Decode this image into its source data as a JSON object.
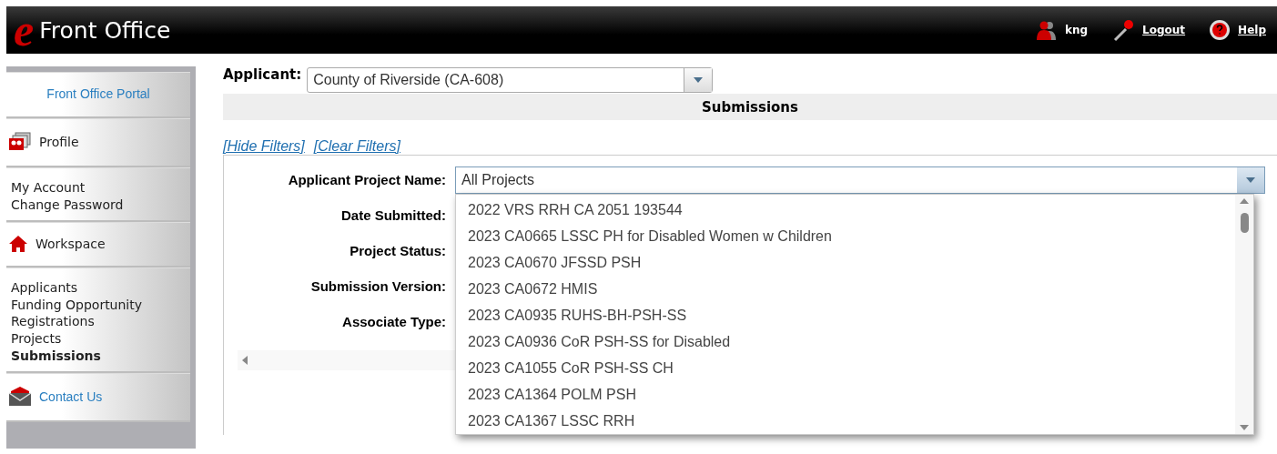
{
  "header": {
    "logo_letter": "e",
    "title": "Front Office",
    "user": "kng",
    "links": [
      {
        "label": "Logout",
        "kind": "logout"
      },
      {
        "label": "Help",
        "kind": "help"
      }
    ]
  },
  "sidebar": {
    "sections": [
      {
        "kind": "portal",
        "label": "Front Office Portal"
      },
      {
        "kind": "profile",
        "label": "Profile",
        "links": [
          {
            "label": "My Account",
            "selected": false
          },
          {
            "label": "Change Password",
            "selected": false
          }
        ]
      },
      {
        "kind": "workspace",
        "label": "Workspace",
        "links": [
          {
            "label": "Applicants",
            "selected": false
          },
          {
            "label": "Funding Opportunity Registrations",
            "selected": false
          },
          {
            "label": "Projects",
            "selected": false
          },
          {
            "label": "Submissions",
            "selected": true
          }
        ]
      },
      {
        "kind": "contact",
        "label": "Contact Us"
      }
    ]
  },
  "applicant": {
    "label": "Applicant:",
    "value": "County of Riverside (CA-608)"
  },
  "section_title": "Submissions",
  "filter_links": [
    "[Hide Filters]",
    "[Clear Filters]"
  ],
  "filters": [
    {
      "label": "Applicant Project Name:",
      "value": "All Projects",
      "expanded": true,
      "options": [
        "2022 VRS RRH CA 2051 193544",
        "2023 CA0665 LSSC PH for Disabled Women w Children",
        "2023 CA0670 JFSSD PSH",
        "2023 CA0672 HMIS",
        "2023 CA0935 RUHS-BH-PSH-SS",
        "2023 CA0936 CoR PSH-SS for Disabled",
        "2023 CA1055 CoR PSH-SS CH",
        "2023 CA1364 POLM PSH",
        "2023 CA1367 LSSC RRH"
      ]
    },
    {
      "label": "Date Submitted:"
    },
    {
      "label": "Project Status:"
    },
    {
      "label": "Submission Version:"
    },
    {
      "label": "Associate Type:"
    }
  ]
}
